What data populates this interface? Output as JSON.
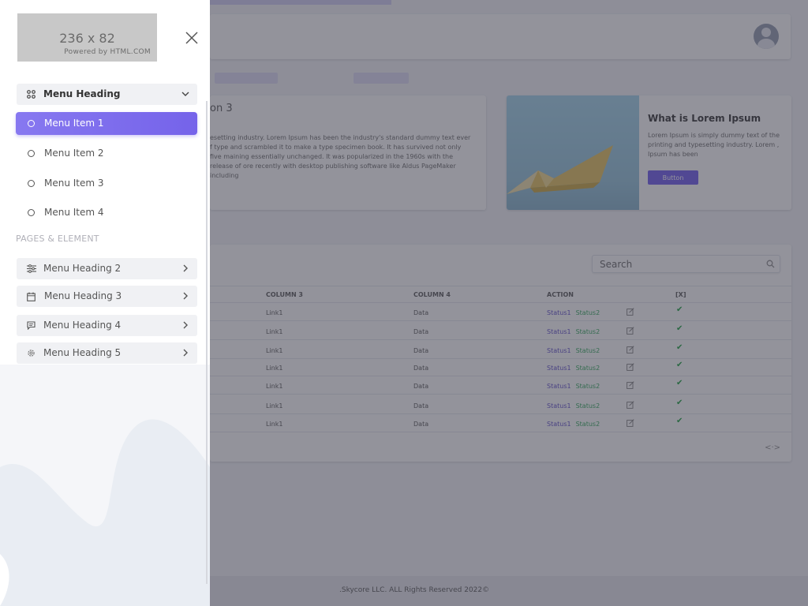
{
  "logo": {
    "size_text": "236 x 82",
    "powered_text": "Powered by HTML.COM"
  },
  "sidebar": {
    "main_heading": "Menu Heading",
    "items": [
      {
        "label": "Menu Item 1",
        "active": true
      },
      {
        "label": "Menu Item 2",
        "active": false
      },
      {
        "label": "Menu Item 3",
        "active": false
      },
      {
        "label": "Menu Item 4",
        "active": false
      }
    ],
    "section_label": "PAGES & ELEMENT",
    "headings": [
      {
        "label": "Menu Heading 2",
        "icon": "sliders-icon"
      },
      {
        "label": "Menu Heading 3",
        "icon": "calendar-icon"
      },
      {
        "label": "Menu Heading 4",
        "icon": "message-icon"
      },
      {
        "label": "Menu Heading 5",
        "icon": "gear-icon"
      }
    ]
  },
  "cards": {
    "card1": {
      "title": "on 3",
      "text": "esetting industry. Lorem Ipsum has been the industry's standard dummy text ever f type and scrambled it to make a type specimen book. It has survived not only five maining essentially unchanged. It was popularized in the 1960s with the release of ore recently with desktop publishing software like Aldus PageMaker including"
    },
    "card2": {
      "title": "What is Lorem Ipsum",
      "text": "Lorem Ipsum is simply dummy text of the printing and typesetting industry. Lorem , Ipsum has been",
      "button": "Button"
    }
  },
  "table": {
    "search_placeholder": "Search",
    "headers": {
      "col3": "COLUMN 3",
      "col4": "COLUMN 4",
      "action": "ACTION",
      "x": "[X]"
    },
    "rows": [
      {
        "col3": "Link1",
        "col4": "Data",
        "status1": "Status1",
        "status2": "Status2"
      },
      {
        "col3": "Link1",
        "col4": "Data",
        "status1": "Status1",
        "status2": "Status2"
      },
      {
        "col3": "Link1",
        "col4": "Data",
        "status1": "Status1",
        "status2": "Status2"
      },
      {
        "col3": "Link1",
        "col4": "Data",
        "status1": "Status1",
        "status2": "Status2"
      },
      {
        "col3": "Link1",
        "col4": "Data",
        "status1": "Status1",
        "status2": "Status2"
      },
      {
        "col3": "Link1",
        "col4": "Data",
        "status1": "Status1",
        "status2": "Status2"
      },
      {
        "col3": "Link1",
        "col4": "Data",
        "status1": "Status1",
        "status2": "Status2"
      }
    ],
    "pager": "<·>"
  },
  "footer": {
    "text": ".Skycore LLC. ALL Rights Reserved 2022©"
  },
  "colors": {
    "accent": "#7563ea",
    "status1": "#6a5acd",
    "status2": "#44b06a"
  }
}
